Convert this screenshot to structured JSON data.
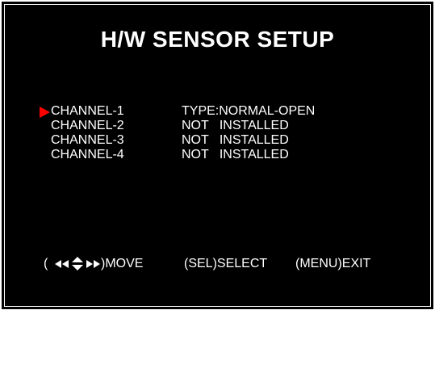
{
  "title": "H/W SENSOR SETUP",
  "channels": [
    {
      "name": "CHANNEL-1",
      "status": "TYPE:NORMAL-OPEN",
      "selected": true
    },
    {
      "name": "CHANNEL-2",
      "status": "NOT   INSTALLED",
      "selected": false
    },
    {
      "name": "CHANNEL-3",
      "status": "NOT   INSTALLED",
      "selected": false
    },
    {
      "name": "CHANNEL-4",
      "status": "NOT   INSTALLED",
      "selected": false
    }
  ],
  "footer": {
    "open_paren": "(",
    "move_label": ")MOVE",
    "select_label": "(SEL)SELECT",
    "exit_label": "(MENU)EXIT"
  },
  "colors": {
    "background": "#000000",
    "text": "#ffffff",
    "cursor": "#ff0000"
  },
  "icons": {
    "cursor": "selection-arrow-icon",
    "move": [
      "arrow-left-icon",
      "arrow-left-icon",
      "arrow-up-icon",
      "arrow-down-icon",
      "arrow-right-icon",
      "arrow-right-icon"
    ]
  }
}
